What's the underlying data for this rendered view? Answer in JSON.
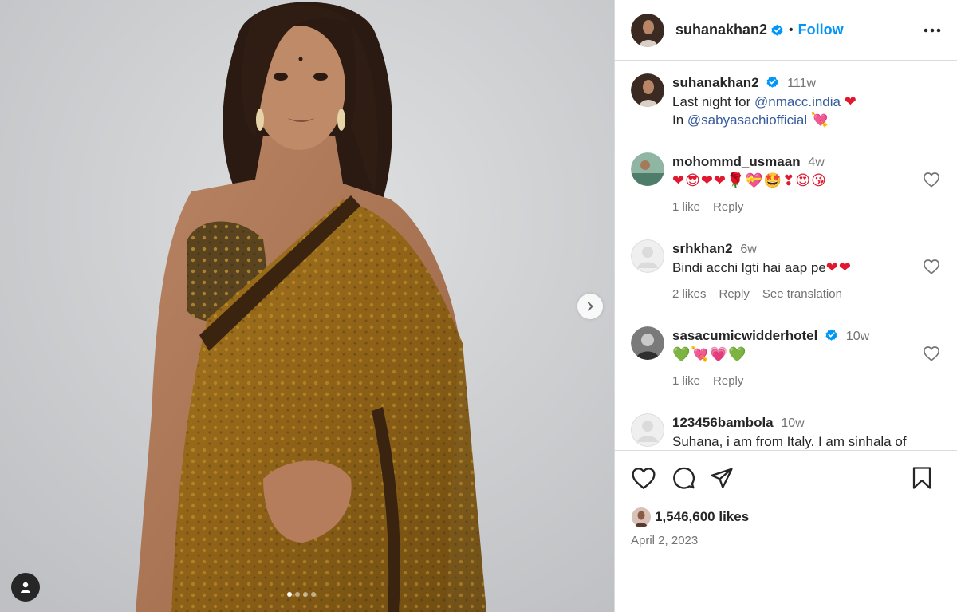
{
  "post": {
    "author": "suhanakhan2",
    "follow_label": "Follow",
    "separator": "•"
  },
  "caption": {
    "username": "suhanakhan2",
    "time": "111w",
    "line1_prefix": "Last night for ",
    "line1_mention": "@nmacc.india",
    "line1_emoji": "❤",
    "line2_prefix": "In ",
    "line2_mention": "@sabyasachiofficial",
    "line2_emoji": "💘"
  },
  "comments": [
    {
      "username": "mohommd_usmaan",
      "time": "4w",
      "text": "❤😎❤❤🌹💝🤩❣😍😘",
      "likes": "1 like",
      "reply": "Reply"
    },
    {
      "username": "srhkhan2",
      "time": "6w",
      "text": "Bindi acchi lgti hai aap pe",
      "text_emoji": "❤❤",
      "likes": "2 likes",
      "reply": "Reply",
      "translate": "See translation"
    },
    {
      "username": "sasacumicwidderhotel",
      "time": "10w",
      "text": "💚💘💗💚",
      "likes": "1 like",
      "reply": "Reply"
    },
    {
      "username": "123456bambola",
      "time": "10w",
      "text": "Suhana, i am from Italy. I am sinhala of"
    }
  ],
  "engagement": {
    "likes": "1,546,600 likes",
    "date": "April 2, 2023"
  },
  "colors": {
    "accent": "#0095f6",
    "link": "#385b9e",
    "verified": "#0095f6"
  },
  "icons": {
    "like": "heart-icon",
    "comment": "comment-icon",
    "share": "paper-plane-icon",
    "save": "bookmark-icon",
    "more": "more-options-icon",
    "next": "chevron-right-icon",
    "tags": "user-tag-icon"
  },
  "carousel": {
    "count": 4,
    "active_index": 0
  }
}
